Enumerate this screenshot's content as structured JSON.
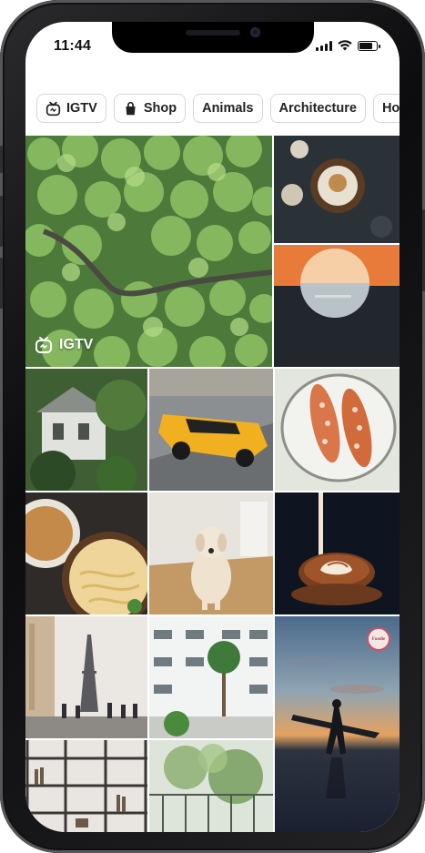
{
  "status_bar": {
    "time": "11:44",
    "icons": [
      "cellular-signal-icon",
      "wifi-icon",
      "battery-icon"
    ],
    "battery_level": 0.85
  },
  "chips": [
    {
      "label": "IGTV",
      "icon": "igtv-icon"
    },
    {
      "label": "Shop",
      "icon": "shopping-bag-icon"
    },
    {
      "label": "Animals"
    },
    {
      "label": "Architecture"
    },
    {
      "label": "Home"
    }
  ],
  "feed": {
    "featured_badge": "IGTV",
    "featured_badge_icon": "igtv-icon",
    "tiles": [
      "forest-aerial-video",
      "food-bowl-overhead",
      "sunset-sea-circle",
      "house-garden",
      "yellow-muscle-car",
      "grilled-corn-plate",
      "noodle-soup-bowls",
      "labrador-dog",
      "latte-art-pour",
      "eiffel-tower-street",
      "white-building-palms",
      "surfer-sunset-beach",
      "bookshelf-room",
      "balcony-plants"
    ],
    "story_avatar_text": "Foodie"
  },
  "colors": {
    "chip_border": "#d6d6d6",
    "text": "#222222",
    "frame": "#1a1a1c"
  }
}
